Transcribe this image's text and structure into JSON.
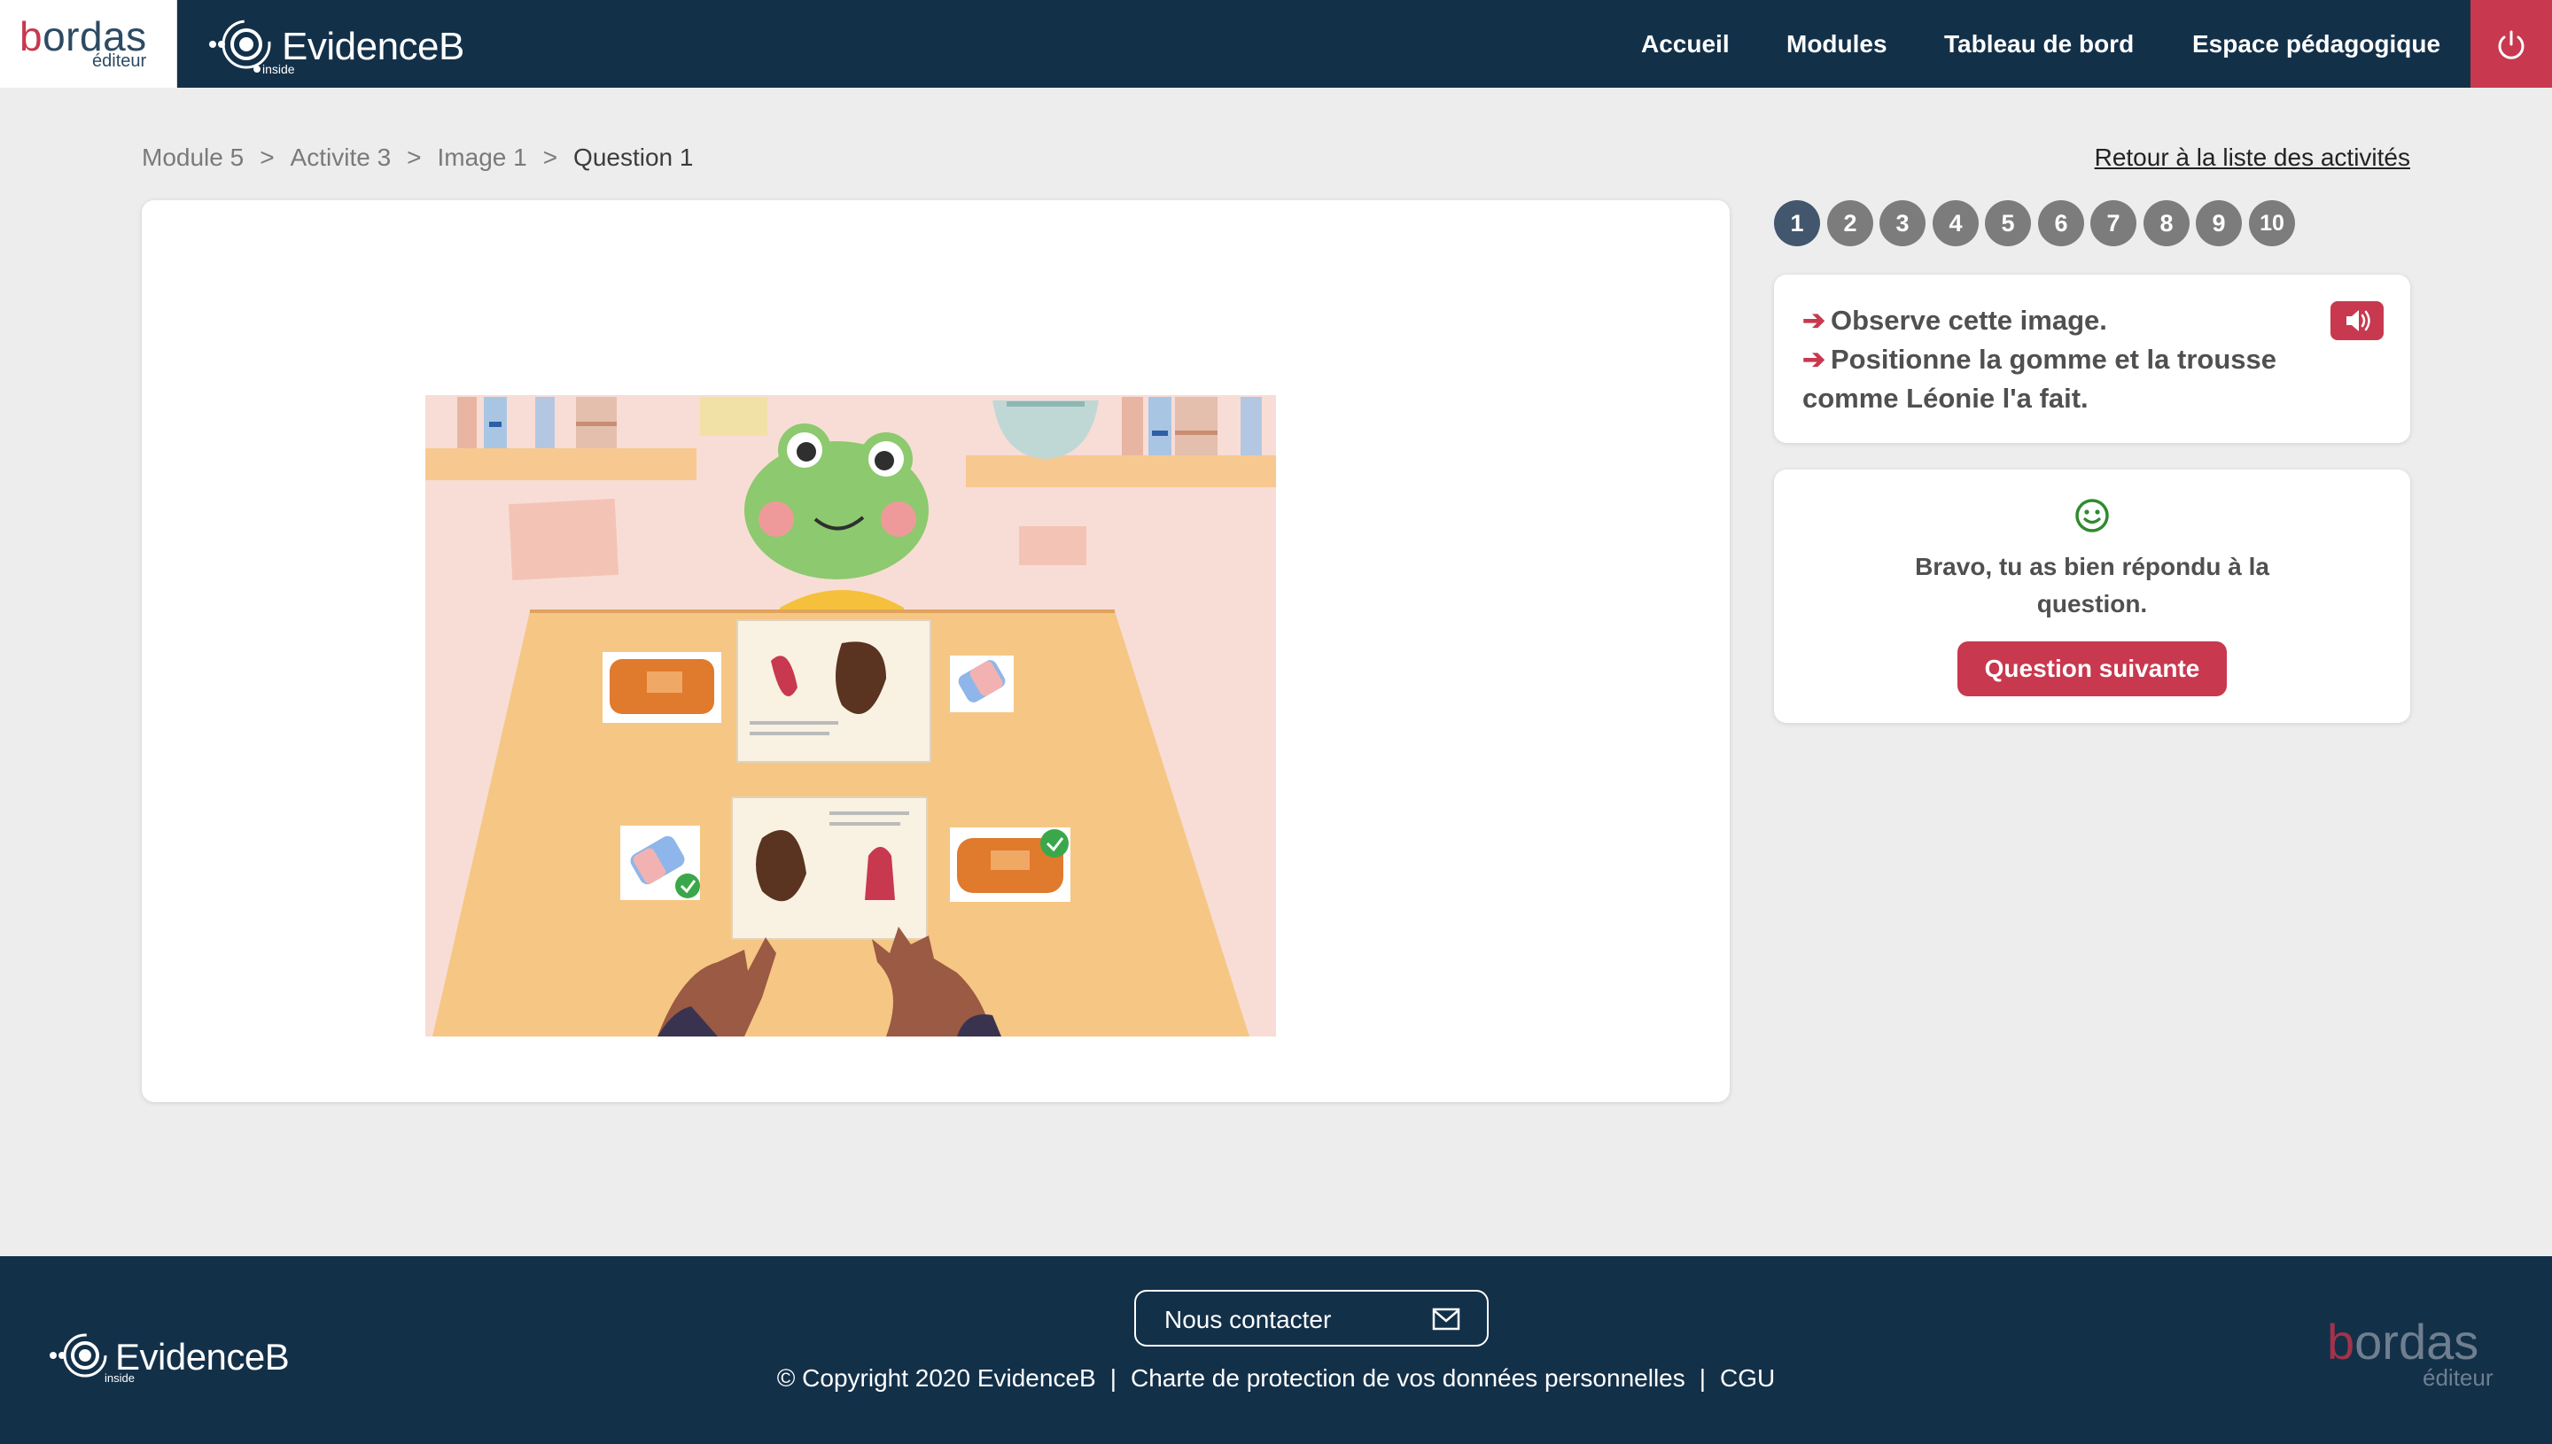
{
  "header": {
    "bordas_logo": {
      "word_accent": "b",
      "word_rest": "ordas",
      "sub": "éditeur"
    },
    "evidenceb_logo": {
      "word": "EvidenceB",
      "sub": "inside"
    },
    "nav": [
      "Accueil",
      "Modules",
      "Tableau de bord",
      "Espace pédagogique"
    ],
    "power_icon": "power-icon"
  },
  "breadcrumb": [
    "Module 5",
    "Activite 3",
    "Image 1",
    "Question 1"
  ],
  "breadcrumb_separator": ">",
  "back_link": "Retour à la liste des activités",
  "questions": {
    "items": [
      "1",
      "2",
      "3",
      "4",
      "5",
      "6",
      "7",
      "8",
      "9",
      "10"
    ],
    "active": "1"
  },
  "instructions": {
    "line1": "Observe cette image.",
    "line2a": "Positionne la gomme et la trousse",
    "line2b": "comme Léonie l'a fait.",
    "arrow_icon": "arrow-right-icon",
    "sound_icon": "speaker-icon"
  },
  "feedback": {
    "icon": "smiley-icon",
    "line1": "Bravo, tu as bien répondu à la",
    "line2": "question.",
    "next_button": "Question suivante"
  },
  "footer": {
    "contact_label": "Nous contacter",
    "mail_icon": "mail-icon",
    "copyright": "© Copyright 2020 EvidenceB",
    "privacy": "Charte de protection de vos données personnelles",
    "cgu": "CGU",
    "separator": "|",
    "evidenceb_logo": {
      "word": "EvidenceB",
      "sub": "inside"
    },
    "bordas_logo": {
      "word_accent": "b",
      "word_rest": "ordas",
      "sub": "éditeur"
    }
  },
  "colors": {
    "navy": "#133049",
    "accent": "#c8384f",
    "pill_inactive": "#7c7c7c",
    "pill_active": "#42566e",
    "success": "#2e8b2e",
    "page_bg": "#ededed"
  }
}
